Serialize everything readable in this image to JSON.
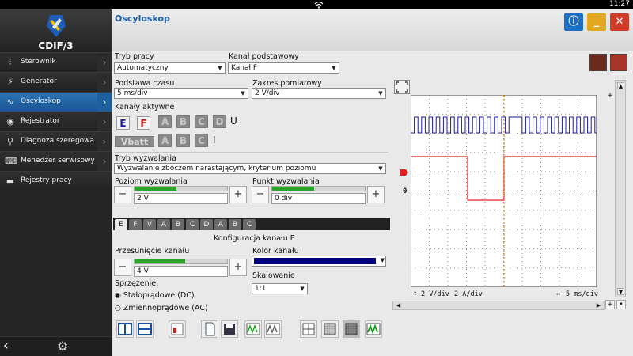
{
  "status_bar": {
    "time": "11:27"
  },
  "app": {
    "name": "CDIF/3"
  },
  "sidebar": {
    "items": [
      {
        "label": "Sterownik",
        "icon": "sliders-icon"
      },
      {
        "label": "Generator",
        "icon": "lightning-icon"
      },
      {
        "label": "Oscyloskop",
        "icon": "waveform-icon",
        "active": true
      },
      {
        "label": "Rejestrator",
        "icon": "record-icon"
      },
      {
        "label": "Diagnoza szeregowa",
        "icon": "probe-icon"
      },
      {
        "label": "Menedżer serwisowy",
        "icon": "keyboard-icon"
      },
      {
        "label": "Rejestry pracy",
        "icon": "folder-icon"
      }
    ]
  },
  "header": {
    "title": "Oscyloskop"
  },
  "form": {
    "mode_label": "Tryb pracy",
    "mode_value": "Automatyczny",
    "base_channel_label": "Kanał podstawowy",
    "base_channel_value": "Kanał F",
    "timebase_label": "Podstawa czasu",
    "timebase_value": "5 ms/div",
    "range_label": "Zakres pomiarowy",
    "range_value": "2 V/div",
    "active_channels_label": "Kanały aktywne",
    "row1": [
      "E",
      "F",
      "A",
      "B",
      "C",
      "D"
    ],
    "row1_suffix": "U",
    "row2_vbatt": "Vbatt",
    "row2": [
      "A",
      "B",
      "C"
    ],
    "row2_suffix": "I",
    "trigger_mode_label": "Tryb wyzwalania",
    "trigger_mode_value": "Wyzwalanie zboczem narastającym, kryterium poziomu",
    "trigger_level_label": "Poziom wyzwalania",
    "trigger_level_value": "2 V",
    "trigger_point_label": "Punkt wyzwalania",
    "trigger_point_value": "0 div"
  },
  "channel_tabs": [
    "E",
    "F",
    "V",
    "A",
    "B",
    "C",
    "D",
    "A",
    "B",
    "C"
  ],
  "channel_config": {
    "title": "Konfiguracja kanału E",
    "offset_label": "Przesunięcie kanału",
    "offset_value": "4 V",
    "color_label": "Kolor kanału",
    "color": "#000080",
    "scaling_label": "Skalowanie",
    "scaling_value": "1:1",
    "coupling_label": "Sprzężenie:",
    "coupling_dc": "Stałoprądowe (DC)",
    "coupling_ac": "Zmiennoprądowe (AC)"
  },
  "scope": {
    "zero_label": "0",
    "readout_v": "2 V/div",
    "readout_a": "2 A/div",
    "readout_t": "5 ms/div",
    "ch_e_color": "#1a1aa0",
    "ch_f_color": "#e02020",
    "trigger_color": "#d97a00"
  },
  "sliders": {
    "trigger_level": 0.45,
    "trigger_point": 0.45,
    "offset": 0.55
  }
}
